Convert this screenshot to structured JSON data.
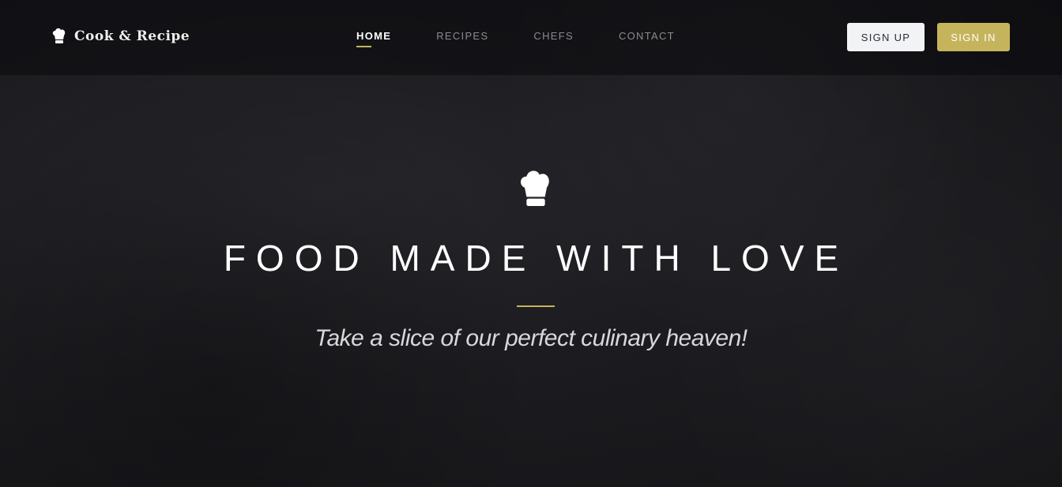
{
  "brand": {
    "name": "Cook & Recipe"
  },
  "nav": [
    {
      "label": "HOME"
    },
    {
      "label": "RECIPES"
    },
    {
      "label": "CHEFS"
    },
    {
      "label": "CONTACT"
    }
  ],
  "auth": {
    "sign_up": "SIGN UP",
    "sign_in": "SIGN IN"
  },
  "hero": {
    "title": "FOOD MADE WITH LOVE",
    "subtitle": "Take a slice of our perfect culinary heaven!"
  },
  "colors": {
    "accent": "#c6b45c"
  }
}
